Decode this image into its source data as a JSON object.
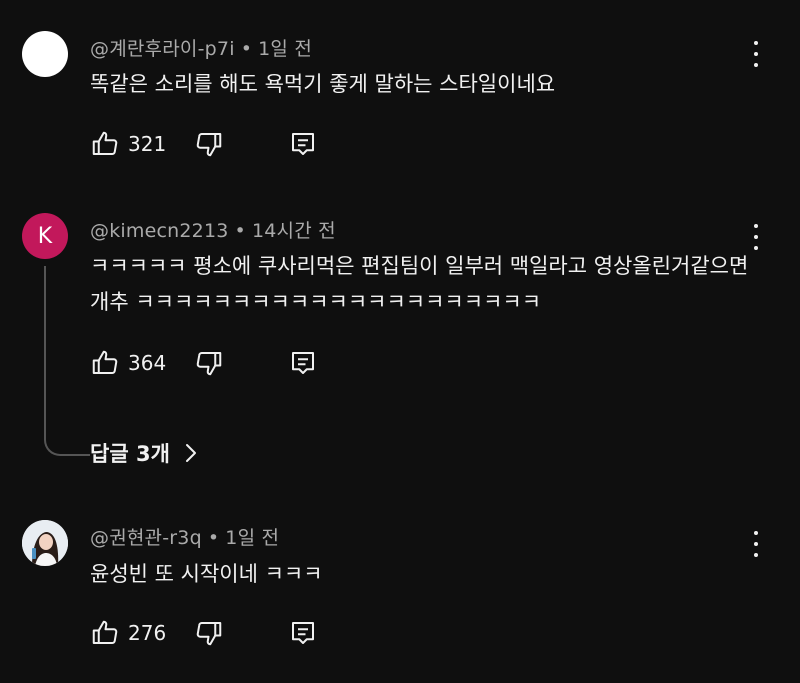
{
  "comments": [
    {
      "author": "@계란후라이-p7i",
      "time": "1일 전",
      "text": "똑같은 소리를 해도 욕먹기 좋게 말하는 스타일이네요",
      "likes": "321",
      "avatar_type": "white"
    },
    {
      "author": "@kimecn2213",
      "time": "14시간 전",
      "text": "ㅋㅋㅋㅋㅋ 평소에 쿠사리먹은 편집팀이 일부러 맥일라고 영상올린거같으면 개추 ㅋㅋㅋㅋㅋㅋㅋㅋㅋㅋㅋㅋㅋㅋㅋㅋㅋㅋㅋㅋㅋ",
      "likes": "364",
      "avatar_letter": "K",
      "avatar_color": "#c2185b",
      "replies_label": "답글 3개"
    },
    {
      "author": "@권현관-r3q",
      "time": "1일 전",
      "text": "윤성빈 또 시작이네 ㅋㅋㅋ",
      "likes": "276",
      "avatar_type": "photo"
    }
  ],
  "separator": "•",
  "icons": {
    "like": "thumb-up-icon",
    "dislike": "thumb-down-icon",
    "reply": "reply-icon",
    "more": "more-vertical-icon",
    "chevron": "chevron-right-icon"
  }
}
